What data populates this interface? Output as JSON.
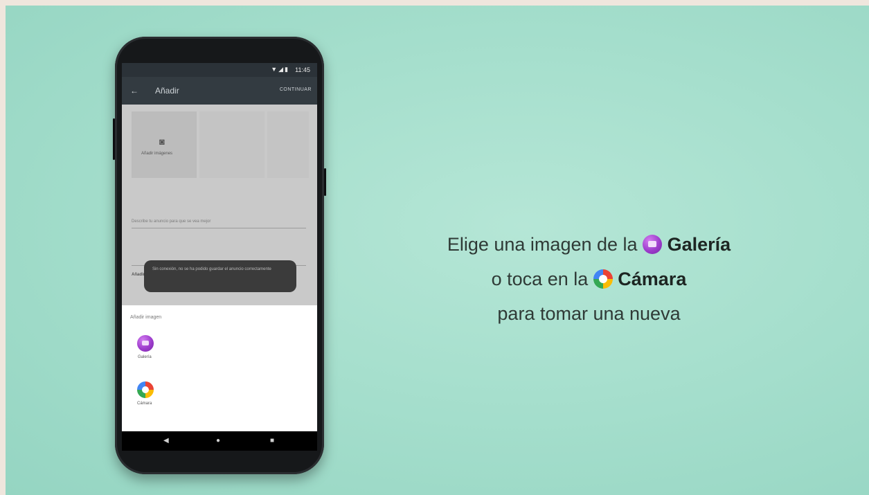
{
  "phone": {
    "status_bar": {
      "time": "11:45",
      "icons": "▼◢▮"
    },
    "app_bar": {
      "back_icon": "arrow-back-icon",
      "title": "Añadir",
      "action": "CONTINUAR"
    },
    "content": {
      "photo_slot_label": "Añadir imágenes",
      "field_hint": "Describe tu anuncio para que se vea mejor",
      "link_text": "Añadir ubicación",
      "snackbar_text": "Sin conexión, no se ha podido guardar el anuncio correctamente"
    },
    "sheet": {
      "heading": "Añadir imagen",
      "apps": [
        {
          "label": "Galería",
          "icon": "gallery-icon"
        },
        {
          "label": "Cámara",
          "icon": "camera-icon"
        }
      ]
    },
    "nav": {
      "back": "◀",
      "home": "●",
      "recents": "■"
    }
  },
  "caption": {
    "line1_prefix": "Elige una imagen de la",
    "line1_bold": "Galería",
    "line2_prefix": "o toca en la",
    "line2_bold": "Cámara",
    "line3": "para tomar una nueva"
  },
  "colors": {
    "background": "#a6dfcd",
    "gallery_purple": "#9d3ccc",
    "app_bar": "#333b41"
  }
}
